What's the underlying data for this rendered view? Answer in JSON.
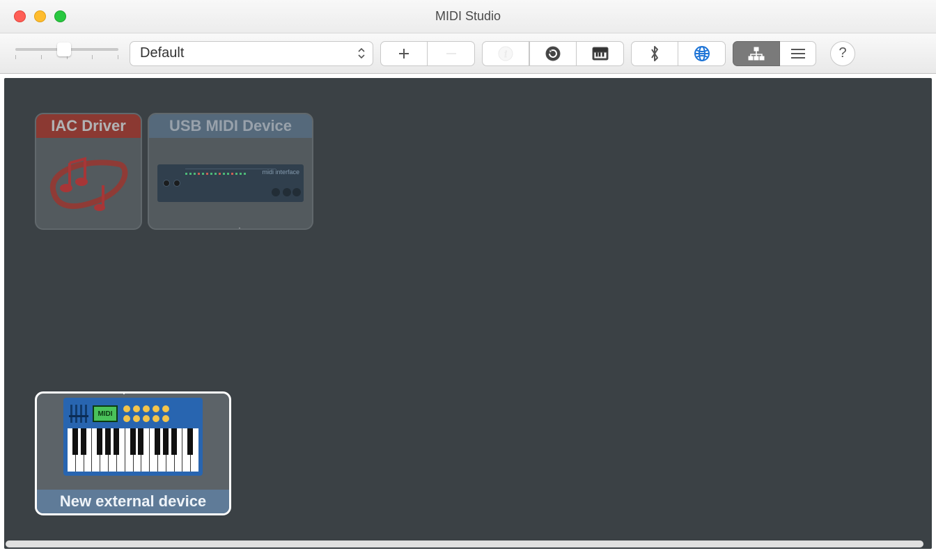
{
  "window": {
    "title": "MIDI Studio"
  },
  "toolbar": {
    "config_selected": "Default",
    "zoom": {
      "value": 40
    }
  },
  "devices": {
    "iac": {
      "title": "IAC Driver"
    },
    "usb": {
      "title": "USB MIDI Device",
      "rack_label": "midi interface"
    },
    "ext": {
      "title": "New external device",
      "screen_label": "MIDI"
    }
  }
}
